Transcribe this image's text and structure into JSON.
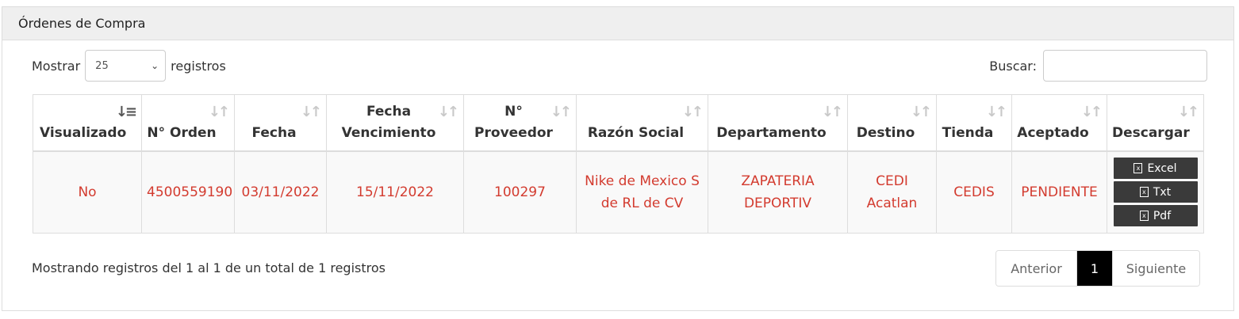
{
  "panel": {
    "title": "Órdenes de Compra"
  },
  "length": {
    "prefix": "Mostrar",
    "value": "25",
    "suffix": "registros"
  },
  "search": {
    "label": "Buscar:",
    "value": ""
  },
  "table": {
    "columns": [
      {
        "label": "Visualizado",
        "sorted": true
      },
      {
        "label": "N° Orden",
        "sorted": false
      },
      {
        "label": "Fecha",
        "sorted": false
      },
      {
        "label": "Fecha Vencimiento",
        "sorted": false
      },
      {
        "label": "N° Proveedor",
        "sorted": false
      },
      {
        "label": "Razón Social",
        "sorted": false
      },
      {
        "label": "Departamento",
        "sorted": false
      },
      {
        "label": "Destino",
        "sorted": false
      },
      {
        "label": "Tienda",
        "sorted": false
      },
      {
        "label": "Aceptado",
        "sorted": false
      },
      {
        "label": "Descargar",
        "sorted": false
      }
    ],
    "rows": [
      {
        "visualizado": "No",
        "orden": "4500559190",
        "fecha": "03/11/2022",
        "vencimiento": "15/11/2022",
        "proveedor": "100297",
        "razon_social": "Nike de Mexico S de RL de CV",
        "departamento": "ZAPATERIA DEPORTIV",
        "destino": "CEDI Acatlan",
        "tienda": "CEDIS",
        "aceptado": "PENDIENTE",
        "downloads": [
          "Excel",
          "Txt",
          "Pdf"
        ]
      }
    ]
  },
  "info": "Mostrando registros del 1 al 1 de un total de 1 registros",
  "pagination": {
    "prev": "Anterior",
    "current": "1",
    "next": "Siguiente"
  },
  "colors": {
    "accent_text": "#d33b2f",
    "current_page": "#000000",
    "download_button": "#3a3a3a"
  }
}
